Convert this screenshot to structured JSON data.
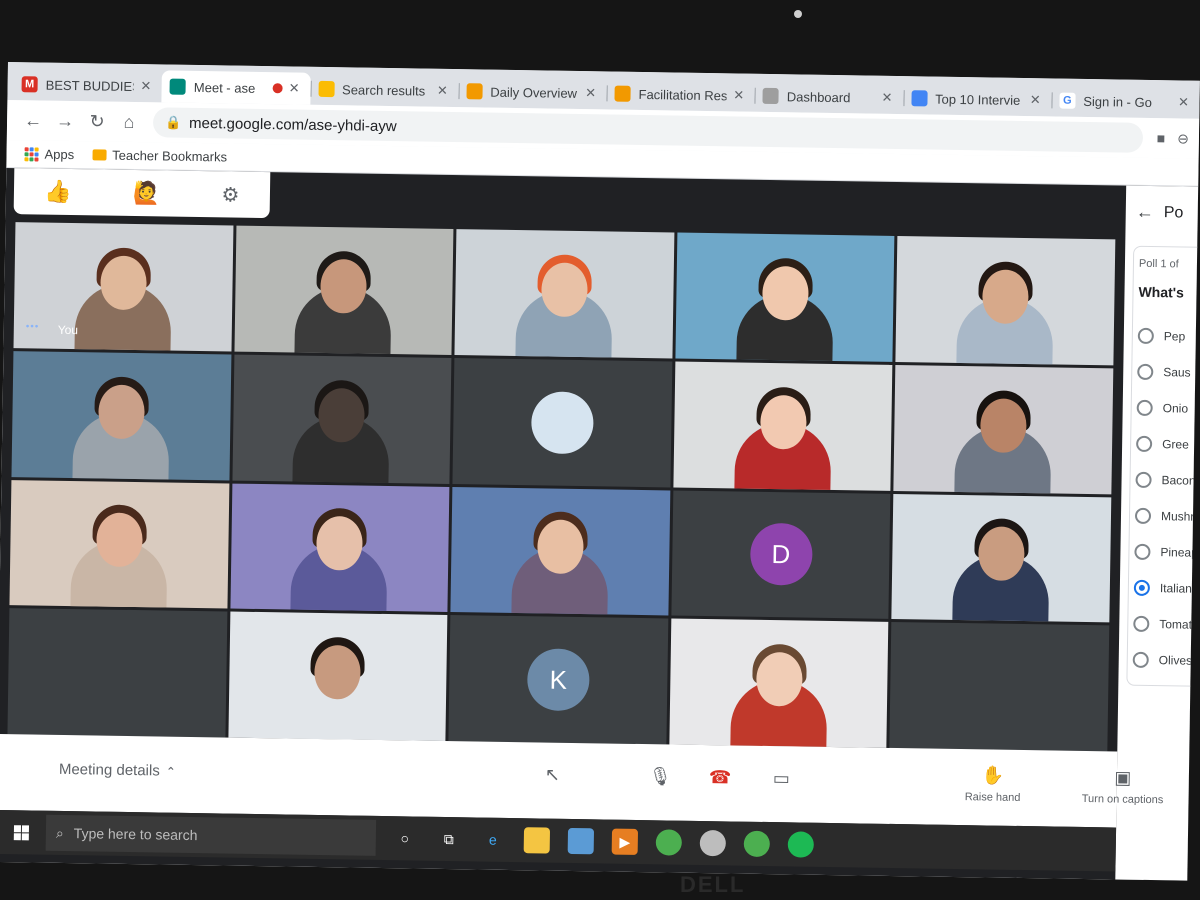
{
  "tabs": [
    {
      "title": "BEST BUDDIES",
      "favicon": "gmail-icon",
      "color": "#d93025",
      "glyph": "M",
      "active": false
    },
    {
      "title": "Meet - ase",
      "favicon": "meet-icon",
      "color": "#00897b",
      "glyph": "",
      "active": true,
      "recording": true
    },
    {
      "title": "Search results",
      "favicon": "drive-icon",
      "color": "#fbbc04",
      "glyph": "",
      "active": false
    },
    {
      "title": "Daily Overview",
      "favicon": "slides-icon",
      "color": "#f29900",
      "glyph": "",
      "active": false
    },
    {
      "title": "Facilitation Res",
      "favicon": "slides-icon",
      "color": "#f29900",
      "glyph": "",
      "active": false
    },
    {
      "title": "Dashboard",
      "favicon": "dashboard-icon",
      "color": "#9e9e9e",
      "glyph": "",
      "active": false
    },
    {
      "title": "Top 10 Intervie",
      "favicon": "docs-icon",
      "color": "#4285f4",
      "glyph": "",
      "active": false
    },
    {
      "title": "Sign in - Go",
      "favicon": "google-icon",
      "color": "#ffffff",
      "glyph": "G",
      "active": false
    }
  ],
  "omnibox": {
    "url": "meet.google.com/ase-yhdi-ayw"
  },
  "bookmarks": {
    "apps": "Apps",
    "folder": "Teacher Bookmarks"
  },
  "reactions": {
    "thumbs": "👍",
    "hand": "🙋"
  },
  "grid": {
    "you_label": "You",
    "tiles": [
      {
        "kind": "video",
        "bg": "#cfd2d6",
        "skin": "#e0b89a",
        "hair": "#5a2f1e",
        "shirt": "#8a6f5d",
        "self": true
      },
      {
        "kind": "video",
        "bg": "#b7b9b6",
        "skin": "#c7977b",
        "hair": "#1e1a17",
        "shirt": "#3b3b3b"
      },
      {
        "kind": "video",
        "bg": "#cdd3d8",
        "skin": "#e8c1a6",
        "hair": "#e35d2d",
        "shirt": "#8fa3b5"
      },
      {
        "kind": "video",
        "bg": "#6fa8c9",
        "skin": "#f0c8ad",
        "hair": "#2c1f16",
        "shirt": "#2d2d2d"
      },
      {
        "kind": "video",
        "bg": "#d4d8dc",
        "skin": "#d7a98a",
        "hair": "#231813",
        "shirt": "#a9b8c8"
      },
      {
        "kind": "video",
        "bg": "#5c7d96",
        "skin": "#caa089",
        "hair": "#261b16",
        "shirt": "#9aa3ab"
      },
      {
        "kind": "video",
        "bg": "#4a4d50",
        "skin": "#4a3e38",
        "hair": "#1b1715",
        "shirt": "#2e2e2e"
      },
      {
        "kind": "avatar",
        "letter": "",
        "bg": "#3c4043",
        "color": "#d6e4f0"
      },
      {
        "kind": "video",
        "bg": "#dcdedf",
        "skin": "#f2c9b1",
        "hair": "#2a1d16",
        "shirt": "#b82a2a"
      },
      {
        "kind": "video",
        "bg": "#cfcfd4",
        "skin": "#b98467",
        "hair": "#17120f",
        "shirt": "#6e7785"
      },
      {
        "kind": "video",
        "bg": "#d9cbbf",
        "skin": "#e2b298",
        "hair": "#4a2a1c",
        "shirt": "#c9b6a6"
      },
      {
        "kind": "video",
        "bg": "#8c86c2",
        "skin": "#e6c0aa",
        "hair": "#3a2519",
        "shirt": "#5b5a9a"
      },
      {
        "kind": "video",
        "bg": "#5f7fb0",
        "skin": "#e8bfa3",
        "hair": "#4d2d1d",
        "shirt": "#6f5e7a"
      },
      {
        "kind": "avatar",
        "letter": "D",
        "bg": "#3c4043",
        "color": "#8e44ad"
      },
      {
        "kind": "video",
        "bg": "#d6dde3",
        "skin": "#c99c80",
        "hair": "#1c1614",
        "shirt": "#2f3b57"
      },
      {
        "kind": "blank"
      },
      {
        "kind": "video",
        "bg": "#e2e6ea",
        "skin": "#c79a7f",
        "hair": "#1f1713",
        "shirt": "#e2e6ea"
      },
      {
        "kind": "avatar",
        "letter": "K",
        "bg": "#3c4043",
        "color": "#6c8aa8"
      },
      {
        "kind": "video",
        "bg": "#e8e8ea",
        "skin": "#f1cdb6",
        "hair": "#6a4a33",
        "shirt": "#c0392b"
      },
      {
        "kind": "blank"
      }
    ]
  },
  "poll": {
    "header": "Po",
    "counter": "Poll 1 of",
    "question": "What's",
    "options": [
      {
        "label": "Pep",
        "selected": false
      },
      {
        "label": "Saus",
        "selected": false
      },
      {
        "label": "Onio",
        "selected": false
      },
      {
        "label": "Gree",
        "selected": false
      },
      {
        "label": "Bacon",
        "selected": false
      },
      {
        "label": "Mushro",
        "selected": false
      },
      {
        "label": "Pineapp",
        "selected": false
      },
      {
        "label": "Italian B",
        "selected": true
      },
      {
        "label": "Tomato",
        "selected": false
      },
      {
        "label": "Olives",
        "selected": false
      }
    ]
  },
  "controls": {
    "meeting_details": "Meeting details",
    "raise_hand": "Raise hand",
    "captions": "Turn on captions"
  },
  "taskbar": {
    "search_placeholder": "Type here to search"
  },
  "brand": "DELL"
}
